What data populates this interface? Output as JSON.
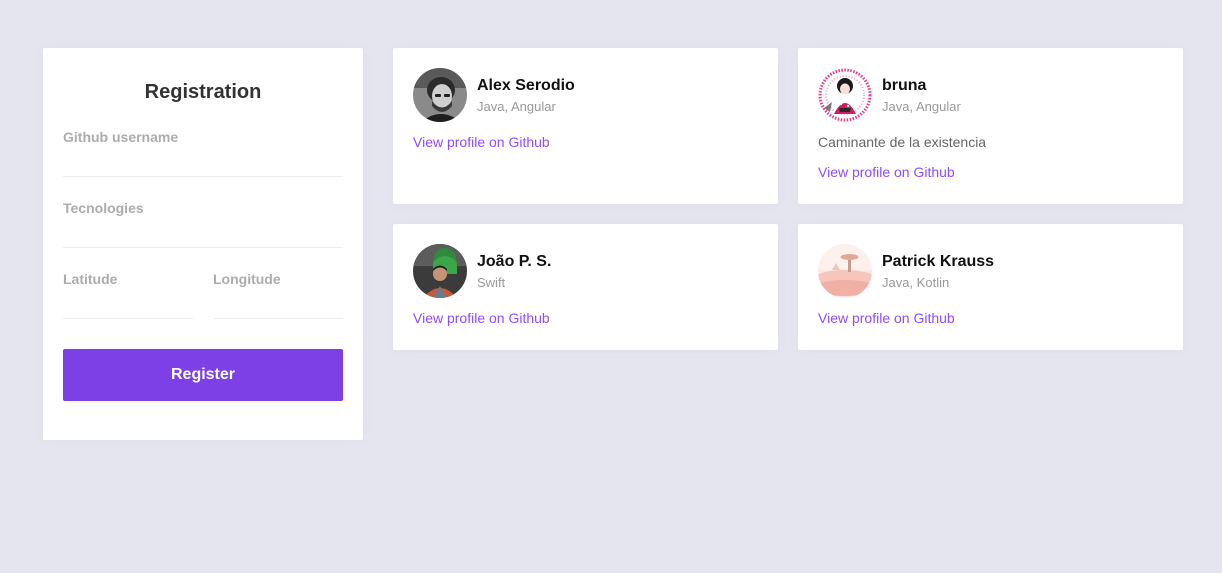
{
  "form": {
    "title": "Registration",
    "github_username_label": "Github username",
    "github_username_value": "",
    "techs_label": "Tecnologies",
    "techs_value": "",
    "latitude_label": "Latitude",
    "latitude_value": "",
    "longitude_label": "Longitude",
    "longitude_value": "",
    "submit_label": "Register"
  },
  "devs": [
    {
      "name": "Alex Serodio",
      "techs": "Java, Angular",
      "bio": "",
      "link_label": "View profile on Github",
      "avatar_icon": "user-photo"
    },
    {
      "name": "bruna",
      "techs": "Java, Angular",
      "bio": "Caminante de la existencia",
      "link_label": "View profile on Github",
      "avatar_icon": "illustrated-avatar"
    },
    {
      "name": "João P. S.",
      "techs": "Swift",
      "bio": "",
      "link_label": "View profile on Github",
      "avatar_icon": "user-photo"
    },
    {
      "name": "Patrick Krauss",
      "techs": "Java, Kotlin",
      "bio": "",
      "link_label": "View profile on Github",
      "avatar_icon": "landscape-avatar"
    }
  ],
  "colors": {
    "background": "#e5e5ef",
    "accent": "#7d40e7",
    "link": "#8e4dff"
  }
}
